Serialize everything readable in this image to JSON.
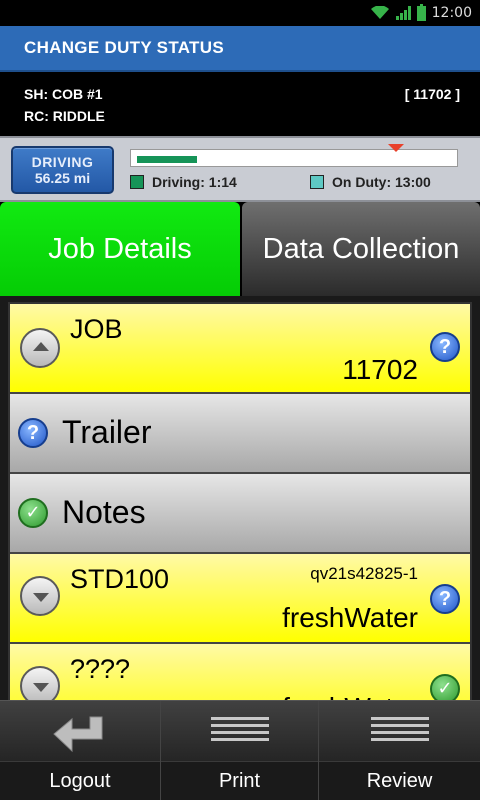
{
  "status_bar": {
    "time": "12:00"
  },
  "header": {
    "title": "CHANGE DUTY STATUS"
  },
  "info": {
    "sh": "SH: COB #1",
    "rc": "RC: RIDDLE",
    "job_number": "[ 11702 ]"
  },
  "hos": {
    "status_label": "DRIVING",
    "distance": "56.25 mi",
    "driving_legend": "Driving: 1:14",
    "onduty_legend": "On Duty: 13:00",
    "driving_fill_fraction": 0.19,
    "marker_fraction": 0.81,
    "driving_color": "#169458",
    "onduty_color": "#5ec9c4"
  },
  "tabs": [
    {
      "label": "Job Details",
      "active": true
    },
    {
      "label": "Data Collection",
      "active": false
    }
  ],
  "list": {
    "job": {
      "title": "JOB",
      "value": "11702"
    },
    "trailer": {
      "title": "Trailer"
    },
    "notes": {
      "title": "Notes"
    },
    "std": {
      "title": "STD100",
      "code": "qv21s42825-1",
      "value": "freshWater"
    },
    "unknown": {
      "title": "????",
      "value": "freshWater"
    }
  },
  "actions": [
    {
      "label": "Logout",
      "icon": "back-arrow-icon"
    },
    {
      "label": "Print",
      "icon": "menu-lines-icon"
    },
    {
      "label": "Review",
      "icon": "menu-lines-icon"
    }
  ]
}
